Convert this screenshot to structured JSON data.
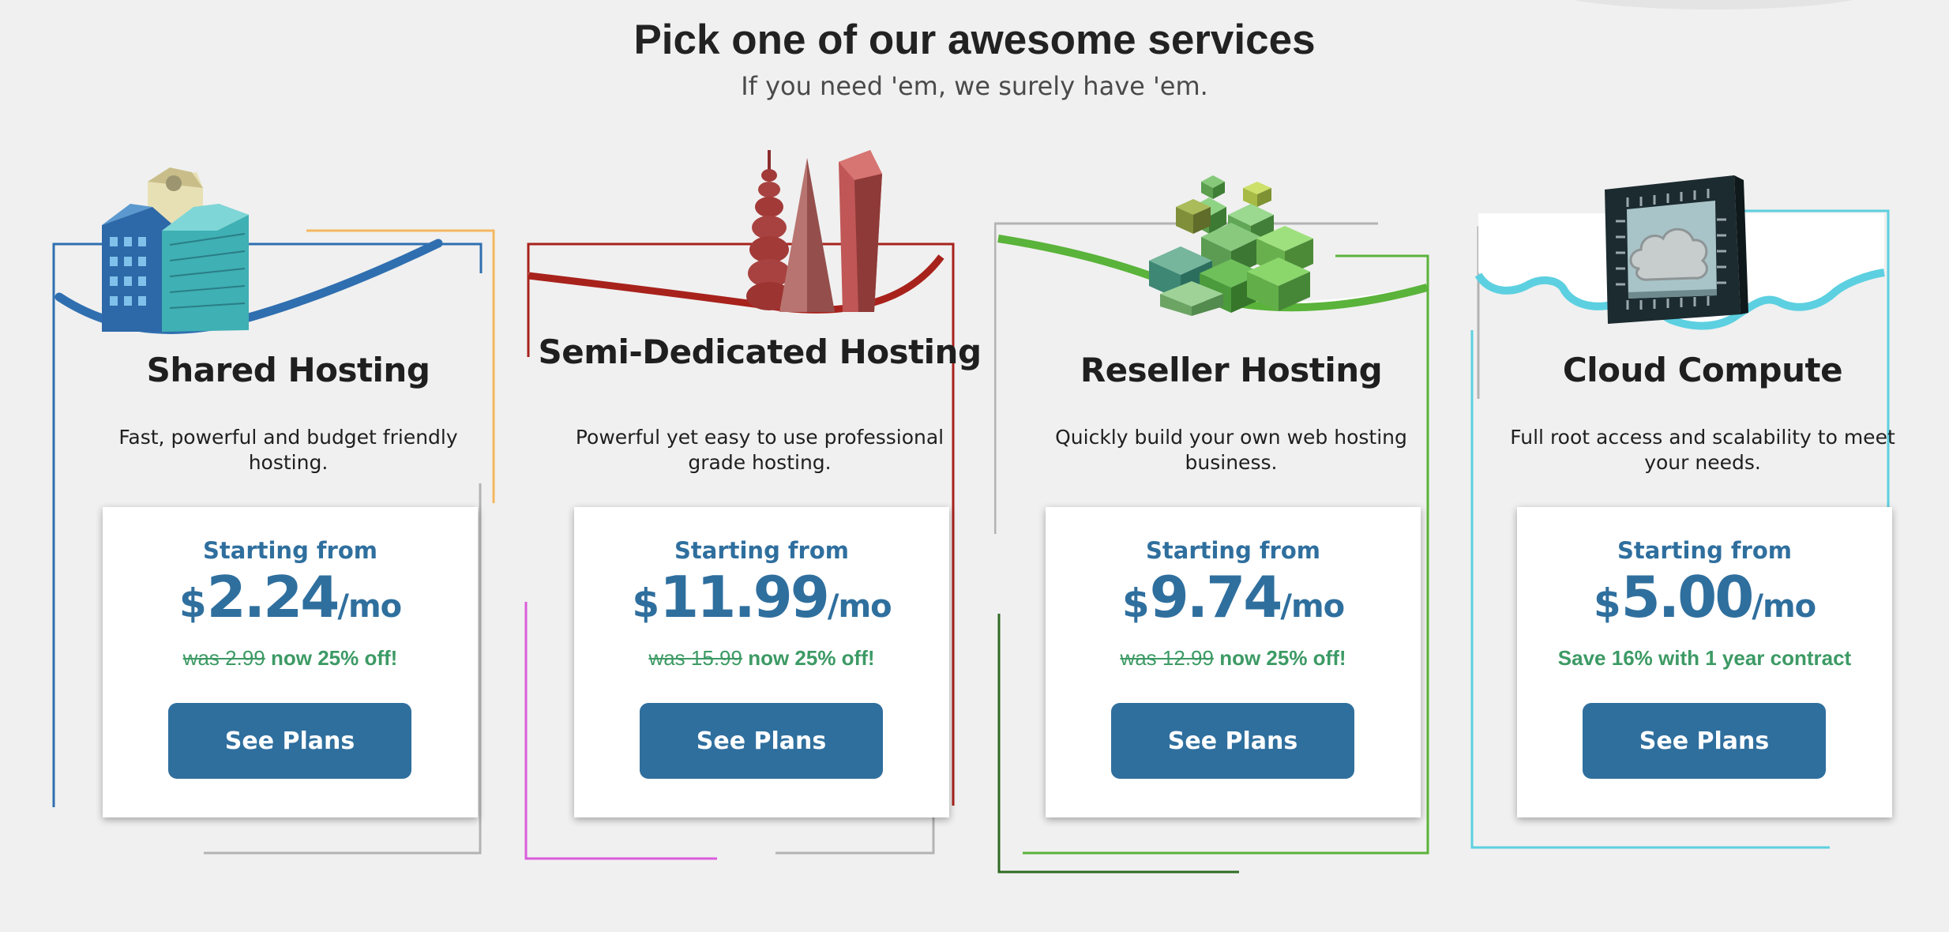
{
  "header": {
    "title": "Pick one of our awesome services",
    "subtitle": "If you need 'em, we surely have 'em."
  },
  "colors": {
    "accent_blue": "#2f6f9e",
    "promo_green": "#3d9a65",
    "shared": "#2f6fb0",
    "semi": "#a8221c",
    "reseller": "#5ab33a",
    "cloud": "#5cd0e0"
  },
  "cards": [
    {
      "title": "Shared Hosting",
      "description": "Fast, powerful and budget friendly hosting.",
      "starting": "Starting from",
      "currency": "$",
      "amount": "2.24",
      "period": "/mo",
      "was": "was 2.99",
      "off": "now 25% off!",
      "button": "See Plans",
      "illustration": "city-buildings-icon"
    },
    {
      "title": "Semi-Dedicated Hosting",
      "description": "Powerful yet easy to use professional grade hosting.",
      "starting": "Starting from",
      "currency": "$",
      "amount": "11.99",
      "period": "/mo",
      "was": "was 15.99",
      "off": "now 25% off!",
      "button": "See Plans",
      "illustration": "towers-icon"
    },
    {
      "title": "Reseller Hosting",
      "description": "Quickly build your own web hosting business.",
      "starting": "Starting from",
      "currency": "$",
      "amount": "9.74",
      "period": "/mo",
      "was": "was 12.99",
      "off": "now 25% off!",
      "button": "See Plans",
      "illustration": "green-cubes-icon"
    },
    {
      "title": "Cloud Compute",
      "description": "Full root access and scalability to meet your needs.",
      "starting": "Starting from",
      "currency": "$",
      "amount": "5.00",
      "period": "/mo",
      "promo": "Save 16% with 1 year contract",
      "button": "See Plans",
      "illustration": "cloud-chip-icon"
    }
  ]
}
